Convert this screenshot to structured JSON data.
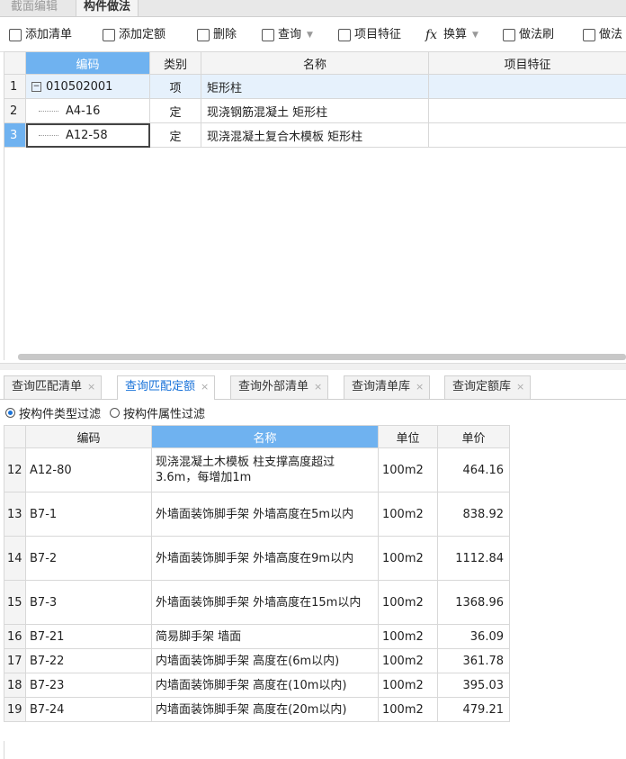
{
  "top_tabs": [
    "截面编辑",
    "构件做法"
  ],
  "toolbar": {
    "add_list": "添加清单",
    "add_quota": "添加定额",
    "delete": "删除",
    "query": "查询",
    "item_feature": "项目特征",
    "calc": "换算",
    "method_brush": "做法刷",
    "method_cut": "做法"
  },
  "upper_grid": {
    "headers": [
      "编码",
      "类别",
      "名称",
      "项目特征"
    ],
    "rows": [
      {
        "num": "1",
        "code": "010502001",
        "type": "项",
        "name": "矩形柱",
        "feature": ""
      },
      {
        "num": "2",
        "code": "A4-16",
        "type": "定",
        "name": "现浇钢筋混凝土 矩形柱",
        "feature": ""
      },
      {
        "num": "3",
        "code": "A12-58",
        "type": "定",
        "name": "现浇混凝土复合木模板 矩形柱",
        "feature": ""
      }
    ]
  },
  "bottom_tabs": [
    "查询匹配清单",
    "查询匹配定额",
    "查询外部清单",
    "查询清单库",
    "查询定额库"
  ],
  "filter": {
    "by_type": "按构件类型过滤",
    "by_attr": "按构件属性过滤"
  },
  "lower_grid": {
    "headers": [
      "编码",
      "名称",
      "单位",
      "单价"
    ],
    "rows": [
      {
        "num": "12",
        "code": "A12-80",
        "name": "现浇混凝土木模板 柱支撑高度超过3.6m，每增加1m",
        "unit": "100m2",
        "price": "464.16"
      },
      {
        "num": "13",
        "code": "B7-1",
        "name": "外墙面装饰脚手架 外墙高度在5m以内",
        "unit": "100m2",
        "price": "838.92"
      },
      {
        "num": "14",
        "code": "B7-2",
        "name": "外墙面装饰脚手架 外墙高度在9m以内",
        "unit": "100m2",
        "price": "1112.84"
      },
      {
        "num": "15",
        "code": "B7-3",
        "name": "外墙面装饰脚手架 外墙高度在15m以内",
        "unit": "100m2",
        "price": "1368.96"
      },
      {
        "num": "16",
        "code": "B7-21",
        "name": "简易脚手架 墙面",
        "unit": "100m2",
        "price": "36.09"
      },
      {
        "num": "17",
        "code": "B7-22",
        "name": "内墙面装饰脚手架 高度在(6m以内)",
        "unit": "100m2",
        "price": "361.78"
      },
      {
        "num": "18",
        "code": "B7-23",
        "name": "内墙面装饰脚手架 高度在(10m以内)",
        "unit": "100m2",
        "price": "395.03"
      },
      {
        "num": "19",
        "code": "B7-24",
        "name": "内墙面装饰脚手架 高度在(20m以内)",
        "unit": "100m2",
        "price": "479.21"
      }
    ]
  },
  "colors": {
    "accent": "#6fb2f0",
    "active_tab_text": "#1a73d9",
    "row_highlight": "#e6f1fc"
  }
}
